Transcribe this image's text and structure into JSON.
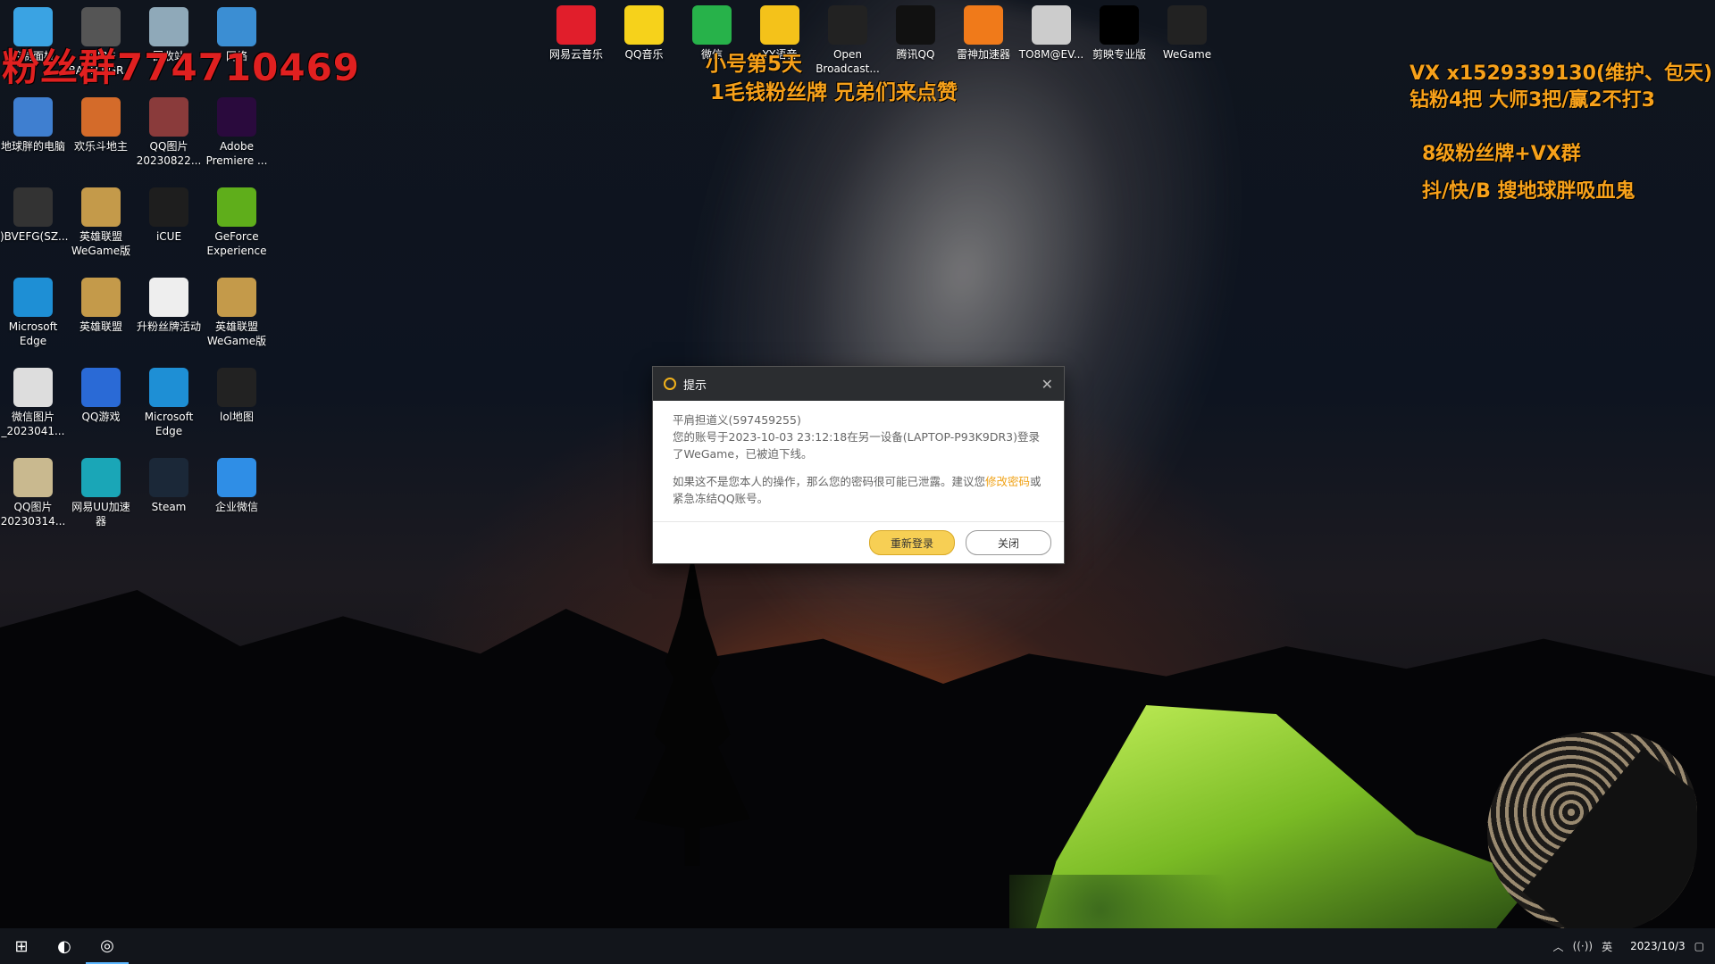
{
  "desktop": {
    "left_icons": [
      {
        "label": "控制面板",
        "icon": "control-panel-icon",
        "color": "#3aa3e3"
      },
      {
        "label": "PUBG BATTLEGR...",
        "icon": "pubg-icon",
        "color": "#555555"
      },
      {
        "label": "回收站",
        "icon": "recycle-bin-icon",
        "color": "#8fa9b9"
      },
      {
        "label": "网络",
        "icon": "network-icon",
        "color": "#3b8ed3"
      },
      {
        "label": "地球胖的电脑",
        "icon": "computer-icon",
        "color": "#3f7fd0"
      },
      {
        "label": "欢乐斗地主",
        "icon": "doudizhu-icon",
        "color": "#d46b2a"
      },
      {
        "label": "QQ图片20230822...",
        "icon": "image-icon",
        "color": "#8a3b3b"
      },
      {
        "label": "Adobe Premiere ...",
        "icon": "premiere-icon",
        "color": "#2a0a3d"
      },
      {
        "label": ")BVEFG(SZ...",
        "icon": "screenshot-icon",
        "color": "#333333"
      },
      {
        "label": "英雄联盟WeGame版",
        "icon": "lol-icon",
        "color": "#c49a4a"
      },
      {
        "label": "iCUE",
        "icon": "icue-icon",
        "color": "#1e1e1e"
      },
      {
        "label": "GeForce Experience",
        "icon": "geforce-icon",
        "color": "#5fae1b"
      },
      {
        "label": "Microsoft Edge",
        "icon": "edge-icon",
        "color": "#1e8fd5"
      },
      {
        "label": "英雄联盟",
        "icon": "lol-icon",
        "color": "#c49a4a"
      },
      {
        "label": "升粉丝牌活动",
        "icon": "document-icon",
        "color": "#eeeeee"
      },
      {
        "label": "英雄联盟WeGame版",
        "icon": "lol-icon",
        "color": "#c49a4a"
      },
      {
        "label": "微信图片_2023041...",
        "icon": "image-icon",
        "color": "#dddddd"
      },
      {
        "label": "QQ游戏",
        "icon": "qq-game-icon",
        "color": "#2a6ad6"
      },
      {
        "label": "Microsoft Edge",
        "icon": "edge-icon",
        "color": "#1e8fd5"
      },
      {
        "label": "lol地图",
        "icon": "map-icon",
        "color": "#222222"
      },
      {
        "label": "QQ图片20230314...",
        "icon": "image-icon",
        "color": "#c9b98f"
      },
      {
        "label": "网易UU加速器",
        "icon": "uu-icon",
        "color": "#1aa6b7"
      },
      {
        "label": "Steam",
        "icon": "steam-icon",
        "color": "#1b2838"
      },
      {
        "label": "企业微信",
        "icon": "wecom-icon",
        "color": "#2f8ee6"
      }
    ],
    "top_icons": [
      {
        "label": "网易云音乐",
        "icon": "netease-music-icon",
        "color": "#e11e2b"
      },
      {
        "label": "QQ音乐",
        "icon": "qq-music-icon",
        "color": "#f6d21b"
      },
      {
        "label": "微信",
        "icon": "wechat-icon",
        "color": "#27b24a"
      },
      {
        "label": "YY语音",
        "icon": "yy-icon",
        "color": "#f4c21a"
      },
      {
        "label": "Open Broadcast...",
        "icon": "obs-icon",
        "color": "#222222"
      },
      {
        "label": "腾讯QQ",
        "icon": "qq-icon",
        "color": "#111111"
      },
      {
        "label": "雷神加速器",
        "icon": "leishen-icon",
        "color": "#f07a1a"
      },
      {
        "label": "TO8M@EV...",
        "icon": "image-icon",
        "color": "#cccccc"
      },
      {
        "label": "剪映专业版",
        "icon": "capcut-icon",
        "color": "#000000"
      },
      {
        "label": "WeGame",
        "icon": "wegame-icon",
        "color": "#222222"
      }
    ]
  },
  "overlay": {
    "red_text": "粉丝群774710469",
    "mid_line1": "小号第5天",
    "mid_line2": "1毛钱粉丝牌 兄弟们来点赞",
    "right_line1": "VX x1529339130(维护、包天)",
    "right_line2": "钻粉4把 大师3把/赢2不打3",
    "right_line3": "8级粉丝牌+VX群",
    "right_line4": "抖/快/B 搜地球胖吸血鬼"
  },
  "dialog": {
    "title": "提示",
    "close_glyph": "✕",
    "line1": "平肩担道义(597459255)",
    "line2": "您的账号于2023-10-03 23:12:18在另一设备(LAPTOP-P93K9DR3)登录了WeGame，已被迫下线。",
    "warn_prefix": "如果这不是您本人的操作，那么您的密码很可能已泄露。建议您",
    "warn_link": "修改密码",
    "warn_suffix": "或紧急冻结QQ账号。",
    "relogin": "重新登录",
    "close": "关闭"
  },
  "taskbar": {
    "start_glyph": "⊞",
    "obs_glyph": "◐",
    "uu_glyph": "◎",
    "tray_up": "︿",
    "tray_ime": "英",
    "tray_wifi": "((·))",
    "date": "2023/10/3",
    "notify_glyph": "▢"
  }
}
